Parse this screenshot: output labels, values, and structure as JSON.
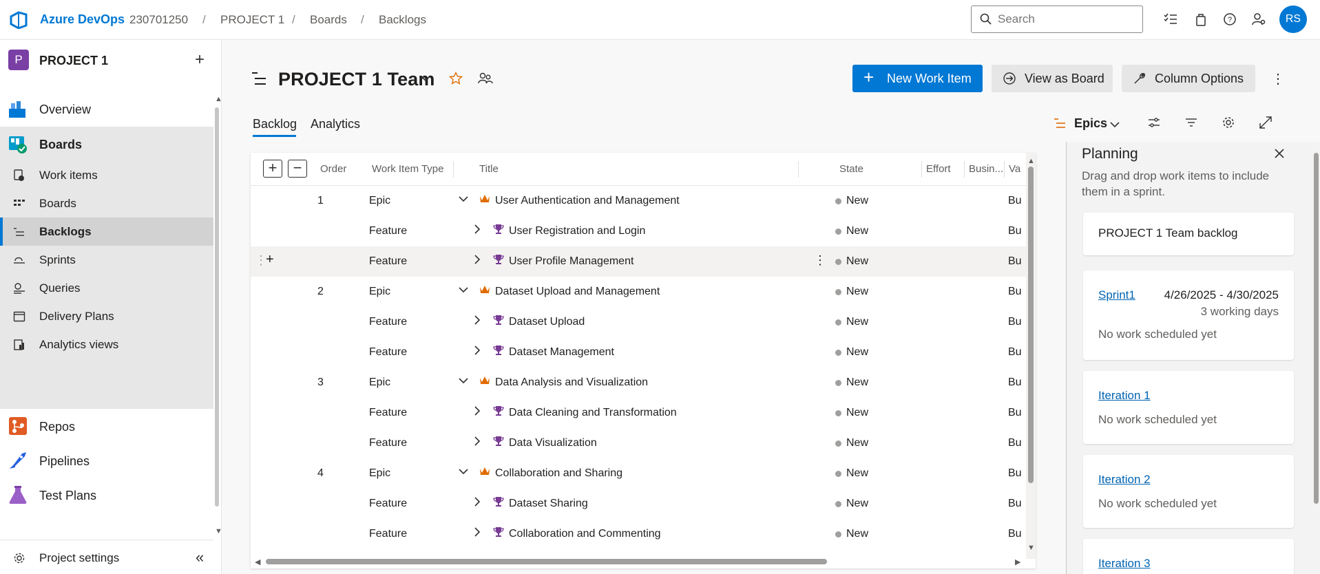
{
  "topbar": {
    "brand": "Azure DevOps",
    "org": "230701250",
    "crumbs": [
      "PROJECT 1",
      "Boards",
      "Backlogs"
    ],
    "search_placeholder": "Search",
    "avatar_initials": "RS"
  },
  "leftnav": {
    "project_initial": "P",
    "project_name": "PROJECT 1",
    "items": {
      "overview": "Overview",
      "boards": "Boards",
      "work_items": "Work items",
      "boards_sub": "Boards",
      "backlogs": "Backlogs",
      "sprints": "Sprints",
      "queries": "Queries",
      "delivery_plans": "Delivery Plans",
      "analytics_views": "Analytics views",
      "repos": "Repos",
      "pipelines": "Pipelines",
      "test_plans": "Test Plans"
    },
    "project_settings": "Project settings"
  },
  "header": {
    "team_title": "PROJECT 1 Team",
    "new_work_item": "New Work Item",
    "view_as_board": "View as Board",
    "column_options": "Column Options"
  },
  "tabs": {
    "backlog": "Backlog",
    "analytics": "Analytics"
  },
  "level_selector": "Epics",
  "grid": {
    "columns": {
      "order": "Order",
      "type": "Work Item Type",
      "title": "Title",
      "state": "State",
      "effort": "Effort",
      "business": "Busin...",
      "value": "Va"
    },
    "rows": [
      {
        "order": "1",
        "type": "Epic",
        "title": "User Authentication and Management",
        "state": "New",
        "val": "Bus"
      },
      {
        "order": "",
        "type": "Feature",
        "title": "User Registration and Login",
        "state": "New",
        "val": "Bus"
      },
      {
        "order": "",
        "type": "Feature",
        "title": "User Profile Management",
        "state": "New",
        "val": "Bus"
      },
      {
        "order": "2",
        "type": "Epic",
        "title": "Dataset Upload and Management",
        "state": "New",
        "val": "Bus"
      },
      {
        "order": "",
        "type": "Feature",
        "title": "Dataset Upload",
        "state": "New",
        "val": "Bus"
      },
      {
        "order": "",
        "type": "Feature",
        "title": "Dataset Management",
        "state": "New",
        "val": "Bus"
      },
      {
        "order": "3",
        "type": "Epic",
        "title": "Data Analysis and Visualization",
        "state": "New",
        "val": "Bus"
      },
      {
        "order": "",
        "type": "Feature",
        "title": "Data Cleaning and Transformation",
        "state": "New",
        "val": "Bus"
      },
      {
        "order": "",
        "type": "Feature",
        "title": "Data Visualization",
        "state": "New",
        "val": "Bus"
      },
      {
        "order": "4",
        "type": "Epic",
        "title": "Collaboration and Sharing",
        "state": "New",
        "val": "Bus"
      },
      {
        "order": "",
        "type": "Feature",
        "title": "Dataset Sharing",
        "state": "New",
        "val": "Bus"
      },
      {
        "order": "",
        "type": "Feature",
        "title": "Collaboration and Commenting",
        "state": "New",
        "val": "Bus"
      }
    ]
  },
  "planning": {
    "title": "Planning",
    "description": "Drag and drop work items to include them in a sprint.",
    "team_backlog": "PROJECT 1 Team backlog",
    "sprint1": {
      "name": "Sprint1",
      "dates": "4/26/2025 - 4/30/2025",
      "days": "3 working days",
      "status": "No work scheduled yet"
    },
    "iteration1": {
      "name": "Iteration 1",
      "status": "No work scheduled yet"
    },
    "iteration2": {
      "name": "Iteration 2",
      "status": "No work scheduled yet"
    },
    "iteration3": {
      "name": "Iteration 3"
    }
  },
  "colors": {
    "accent": "#0078d4",
    "epic": "#e06c00",
    "feature": "#773b93",
    "project_tile": "#7a3fa5"
  }
}
